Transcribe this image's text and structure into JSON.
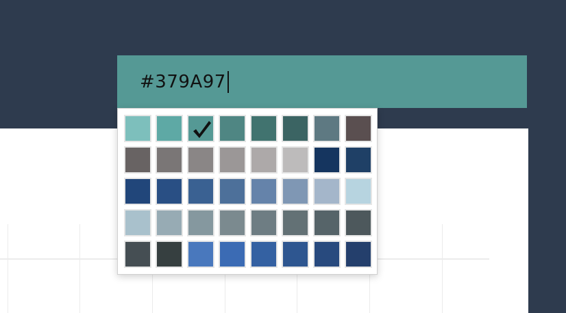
{
  "color_input": {
    "value": "#379A97"
  },
  "palette": {
    "selected_index": 2,
    "swatches": [
      "#7dbfbc",
      "#5ea9a5",
      "#559995",
      "#4f8683",
      "#41736f",
      "#3b6463",
      "#5e7982",
      "#5a4f50",
      "#686363",
      "#7a7676",
      "#8a8686",
      "#9b9797",
      "#ada9a9",
      "#bdbbbb",
      "#15355f",
      "#1f4066",
      "#21467a",
      "#294f84",
      "#3a6192",
      "#4d709a",
      "#6583aa",
      "#7f97b4",
      "#a4b6ca",
      "#b7d4e0",
      "#a9c1cc",
      "#97abb4",
      "#85989f",
      "#7b8a8f",
      "#6e7d83",
      "#637175",
      "#566469",
      "#4d585c",
      "#454e53",
      "#363f40",
      "#4978bd",
      "#3b6bb4",
      "#3461a2",
      "#2e5690",
      "#284a7e",
      "#243f6c"
    ]
  }
}
